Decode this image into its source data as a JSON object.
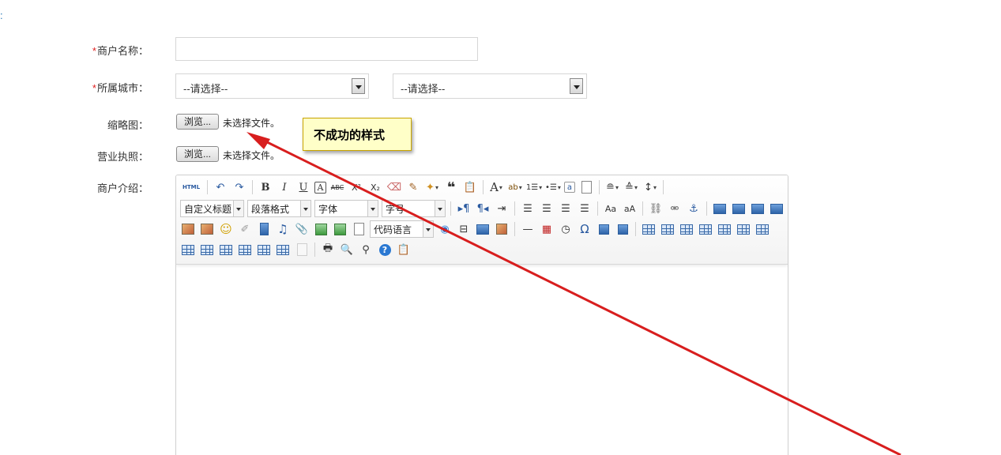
{
  "page": {
    "corner_colon": ":"
  },
  "form": {
    "merchant_name": {
      "required_mark": "*",
      "label": "商户名称：",
      "value": ""
    },
    "city": {
      "required_mark": "*",
      "label": "所属城市：",
      "province_select": "--请选择--",
      "city_select": "--请选择--"
    },
    "thumbnail": {
      "label": "缩略图：",
      "browse_label": "浏览...",
      "status": "未选择文件。"
    },
    "license": {
      "label": "营业执照：",
      "browse_label": "浏览...",
      "status": "未选择文件。"
    },
    "intro": {
      "label": "商户介绍："
    }
  },
  "annotation": {
    "text": "不成功的样式",
    "arrow_color": "#d81e1e"
  },
  "editor": {
    "html_button": "HTML",
    "combos": {
      "custom_heading": "自定义标题",
      "paragraph": "段落格式",
      "font_family": "字体",
      "font_size": "字号",
      "code_language": "代码语言"
    },
    "glyphs": {
      "bold": "B",
      "italic": "I",
      "underline": "U",
      "font_border": "A",
      "strike": "ABC",
      "superscript": "X²",
      "subscript": "X₂",
      "blockquote": "❝",
      "font_color": "A",
      "ordered_list": "1☰",
      "unordered_list": "•☰",
      "horizontal_rule": "—",
      "special_char": "Ω",
      "help": "?"
    }
  }
}
